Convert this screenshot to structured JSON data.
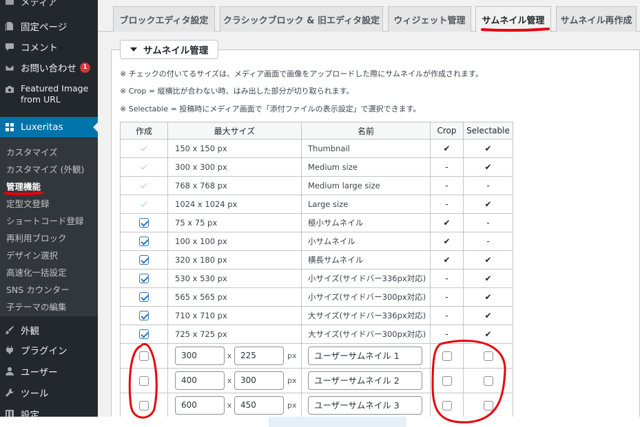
{
  "sidebar": {
    "partial_top_label": "メディア",
    "items": [
      {
        "label": "固定ページ",
        "icon": "page-icon"
      },
      {
        "label": "コメント",
        "icon": "comment-icon"
      },
      {
        "label": "お問い合わせ",
        "icon": "mail-icon",
        "badge": "1"
      },
      {
        "label": "Featured Image from URL",
        "icon": "camera-icon"
      },
      {
        "label": "Luxeritas",
        "icon": "grid-icon"
      }
    ],
    "submenu": [
      "カスタマイズ",
      "カスタマイズ (外観)",
      "管理機能",
      "定型文登録",
      "ショートコード登録",
      "再利用ブロック",
      "デザイン選択",
      "高速化一括設定",
      "SNS カウンター",
      "子テーマの編集"
    ],
    "bottom_items": [
      {
        "label": "外観",
        "icon": "paintbrush-icon"
      },
      {
        "label": "プラグイン",
        "icon": "plugin-icon"
      },
      {
        "label": "ユーザー",
        "icon": "user-icon"
      },
      {
        "label": "ツール",
        "icon": "wrench-icon"
      },
      {
        "label": "設定",
        "icon": "settings-icon"
      }
    ]
  },
  "tabs": [
    "ブロックエディタ設定",
    "クラシックブロック & 旧エディタ設定",
    "ウィジェット管理",
    "サムネイル管理",
    "サムネイル再作成"
  ],
  "active_tab_index": 3,
  "section": {
    "title": "サムネイル管理",
    "notes": [
      "※ チェックの付いてるサイズは、メディア画面で画像をアップロードした際にサムネイルが作成されます。",
      "※ Crop = 縦横比が合わない時、はみ出した部分が切り取られます。",
      "※ Selectable = 投稿時にメディア画面で「添付ファイルの表示設定」で選択できます。"
    ]
  },
  "table": {
    "headers": [
      "作成",
      "最大サイズ",
      "名前",
      "Crop",
      "Selectable"
    ],
    "rows": [
      {
        "size": "150 x 150 px",
        "name": "Thumbnail",
        "crop": "✔",
        "selectable": "✔",
        "check": "disabled"
      },
      {
        "size": "300 x 300 px",
        "name": "Medium size",
        "crop": "-",
        "selectable": "✔",
        "check": "disabled"
      },
      {
        "size": "768 x 768 px",
        "name": "Medium large size",
        "crop": "-",
        "selectable": "-",
        "check": "disabled"
      },
      {
        "size": "1024 x 1024 px",
        "name": "Large size",
        "crop": "-",
        "selectable": "✔",
        "check": "disabled"
      },
      {
        "size": "75 x 75 px",
        "name": "極小サムネイル",
        "crop": "✔",
        "selectable": "-",
        "check": "on"
      },
      {
        "size": "100 x 100 px",
        "name": "小サムネイル",
        "crop": "✔",
        "selectable": "-",
        "check": "on"
      },
      {
        "size": "320 x 180 px",
        "name": "横長サムネイル",
        "crop": "✔",
        "selectable": "✔",
        "check": "on"
      },
      {
        "size": "530 x 530 px",
        "name": "小サイズ(サイドバー336px対応)",
        "crop": "-",
        "selectable": "✔",
        "check": "on"
      },
      {
        "size": "565 x 565 px",
        "name": "小サイズ(サイドバー300px対応)",
        "crop": "-",
        "selectable": "✔",
        "check": "on"
      },
      {
        "size": "710 x 710 px",
        "name": "大サイズ(サイドバー336px対応)",
        "crop": "-",
        "selectable": "✔",
        "check": "on"
      },
      {
        "size": "725 x 725 px",
        "name": "大サイズ(サイドバー300px対応)",
        "crop": "-",
        "selectable": "✔",
        "check": "on"
      }
    ],
    "custom_rows": [
      {
        "width": "300",
        "height": "225",
        "name": "ユーザーサムネイル 1"
      },
      {
        "width": "400",
        "height": "300",
        "name": "ユーザーサムネイル 2"
      },
      {
        "width": "600",
        "height": "450",
        "name": "ユーザーサムネイル 3"
      }
    ],
    "x_label": "x",
    "px_label": "px"
  },
  "colors": {
    "sidebar_bg": "#23282d",
    "submenu_bg": "#32373c",
    "accent": "#0073aa",
    "annotation_red": "#e8000b",
    "checkbox_checked": "#2c74b3"
  }
}
